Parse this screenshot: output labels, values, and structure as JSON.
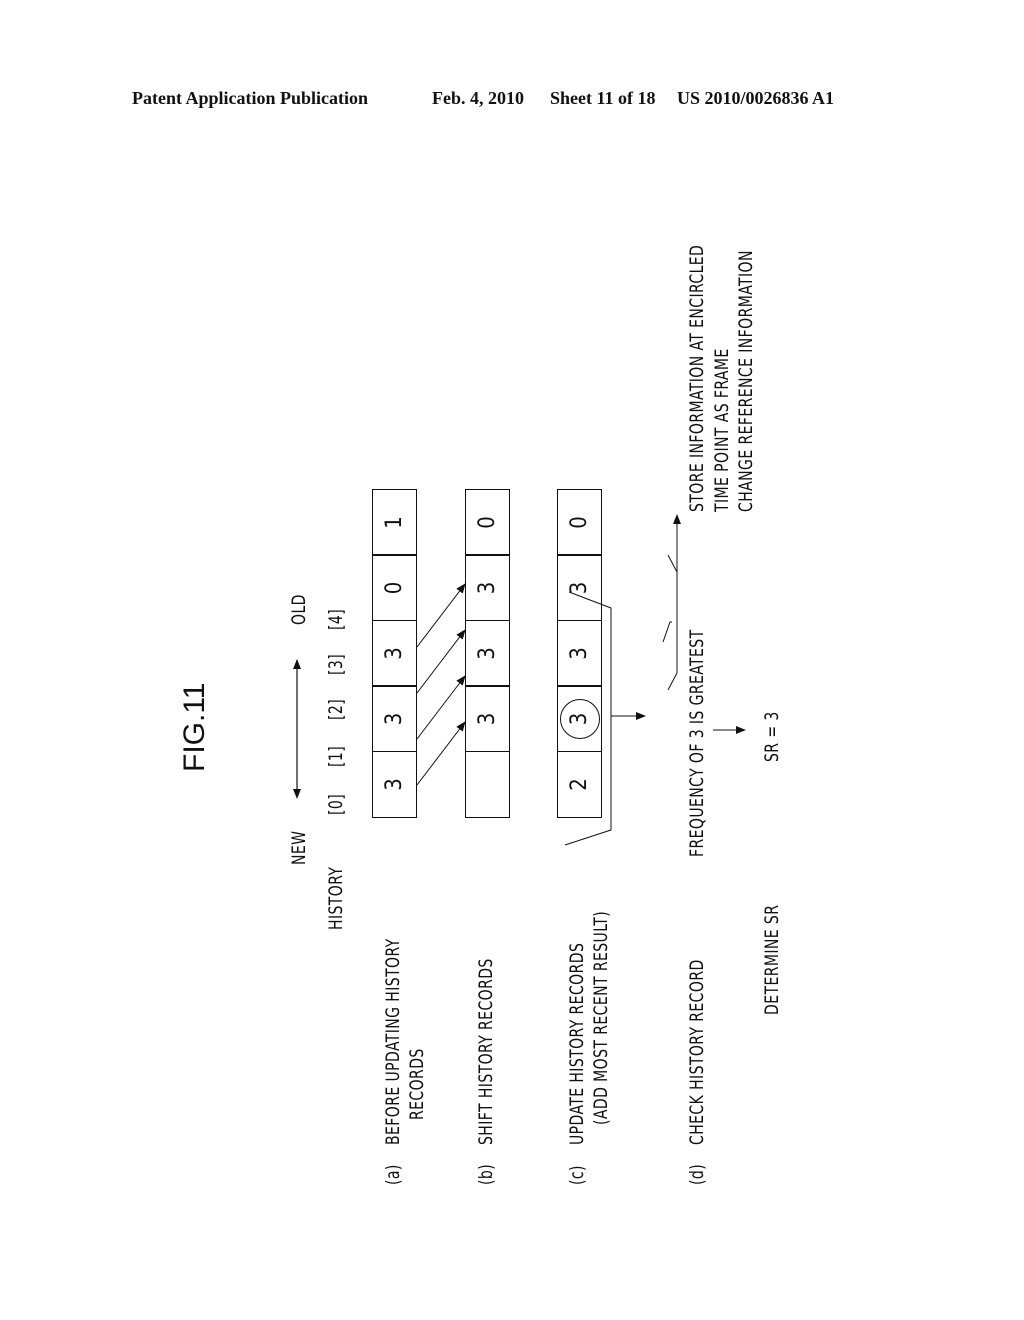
{
  "header": {
    "publication": "Patent Application Publication",
    "date": "Feb. 4, 2010",
    "sheet": "Sheet 11 of 18",
    "number": "US 2010/0026836 A1"
  },
  "figure": {
    "title": "FIG.11",
    "direction": {
      "new": "NEW",
      "old": "OLD"
    },
    "history_label": "HISTORY",
    "indices": [
      "[0]",
      "[1]",
      "[2]",
      "[3]",
      "[4]"
    ],
    "steps": [
      {
        "label": "(a)",
        "text_lines": [
          "BEFORE UPDATING HISTORY",
          "RECORDS"
        ],
        "cells": [
          "3",
          "3",
          "3",
          "0",
          "1"
        ]
      },
      {
        "label": "(b)",
        "text_lines": [
          "SHIFT HISTORY RECORDS"
        ],
        "cells": [
          "",
          "3",
          "3",
          "3",
          "0"
        ]
      },
      {
        "label": "(c)",
        "text_lines": [
          "UPDATE HISTORY RECORDS",
          "(ADD MOST RECENT RESULT)"
        ],
        "cells": [
          "2",
          "3",
          "3",
          "3",
          "0"
        ],
        "circled_index": 1
      },
      {
        "label": "(d)",
        "text_lines": [
          "CHECK HISTORY RECORD"
        ]
      }
    ],
    "result": "FREQUENCY OF 3 IS GREATEST",
    "determine_label": "DETERMINE SR",
    "sr_value": "SR = 3",
    "store_note": [
      "STORE INFORMATION AT ENCIRCLED",
      "TIME POINT AS FRAME",
      "CHANGE REFERENCE INFORMATION"
    ]
  }
}
